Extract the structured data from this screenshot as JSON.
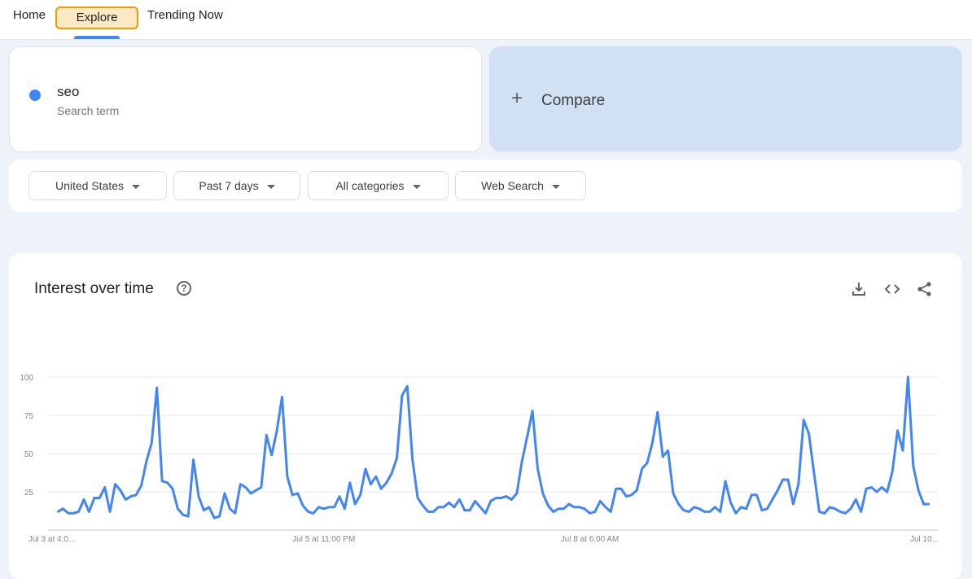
{
  "nav": {
    "home": "Home",
    "explore": "Explore",
    "trending": "Trending Now"
  },
  "search_term": {
    "name": "seo",
    "subtitle": "Search term",
    "color": "#4285f4"
  },
  "compare": {
    "plus": "+",
    "label": "Compare"
  },
  "filters": {
    "region": "United States",
    "period": "Past 7 days",
    "category": "All categories",
    "search_type": "Web Search"
  },
  "chart_card": {
    "title": "Interest over time",
    "help_icon": "help-icon",
    "actions": [
      "download-icon",
      "embed-code-icon",
      "share-icon"
    ]
  },
  "chart_data": {
    "type": "line",
    "title": "Interest over time",
    "xlabel": "",
    "ylabel": "",
    "ylim": [
      0,
      100
    ],
    "yticks": [
      25,
      50,
      75,
      100
    ],
    "xtick_labels": [
      "Jul 3 at 4:0...",
      "Jul 5 at 11:00 PM",
      "Jul 8 at 6:00 AM",
      "Jul 10..."
    ],
    "xtick_positions": [
      0,
      51,
      102,
      153
    ],
    "grid": true,
    "line_color": "#4285f4",
    "series": [
      {
        "values": [
          12,
          14,
          11,
          11,
          12,
          20,
          12,
          21,
          21,
          28,
          12,
          30,
          26,
          20,
          22,
          23,
          29,
          45,
          57,
          93,
          32,
          31,
          27,
          14,
          10,
          9,
          46,
          22,
          13,
          15,
          8,
          9,
          24,
          14,
          11,
          30,
          28,
          24,
          26,
          28,
          62,
          49,
          65,
          87,
          35,
          23,
          24,
          16,
          12,
          11,
          15,
          14,
          15,
          15,
          22,
          14,
          31,
          17,
          23,
          40,
          30,
          35,
          27,
          31,
          37,
          47,
          88,
          94,
          46,
          21,
          16,
          12,
          12,
          15,
          15,
          18,
          15,
          20,
          13,
          13,
          19,
          15,
          11,
          19,
          21,
          21,
          22,
          20,
          24,
          45,
          61,
          78,
          40,
          24,
          16,
          12,
          14,
          14,
          17,
          15,
          15,
          14,
          11,
          12,
          19,
          15,
          12,
          27,
          27,
          22,
          23,
          26,
          40,
          44,
          57,
          77,
          48,
          52,
          24,
          17,
          13,
          12,
          15,
          14,
          12,
          12,
          15,
          12,
          32,
          18,
          11,
          15,
          14,
          23,
          23,
          13,
          14,
          20,
          26,
          33,
          33,
          17,
          30,
          72,
          63,
          37,
          12,
          11,
          15,
          14,
          12,
          11,
          14,
          20,
          12,
          27,
          28,
          25,
          28,
          25,
          38,
          65,
          52,
          100,
          42,
          26,
          17,
          17
        ]
      }
    ]
  }
}
